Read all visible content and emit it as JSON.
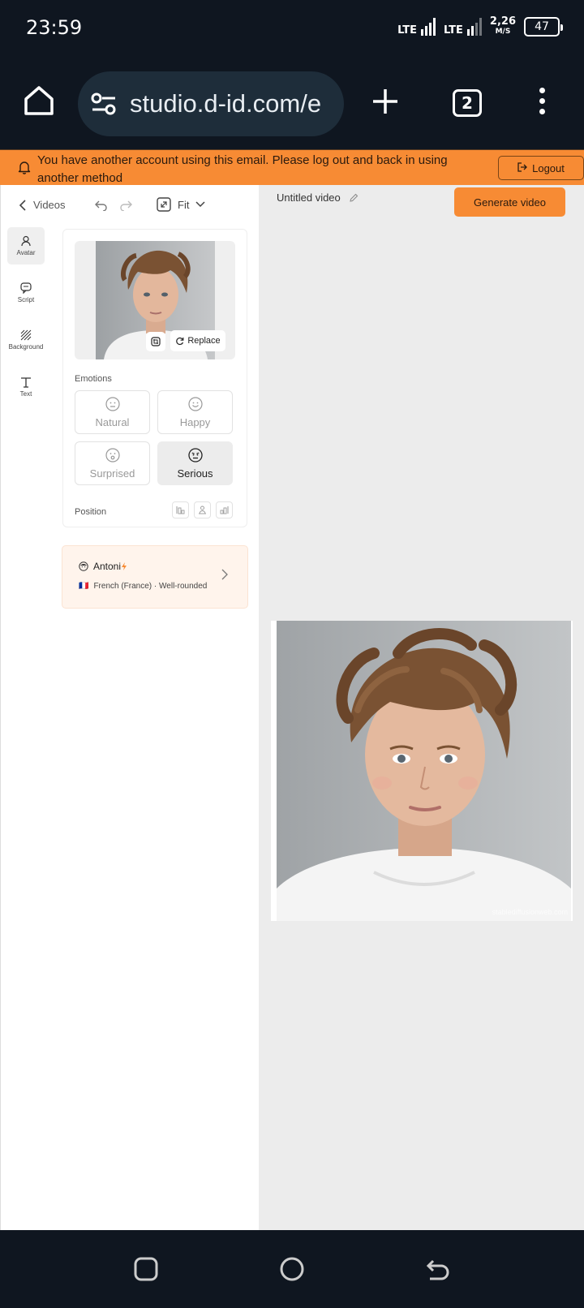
{
  "status": {
    "time": "23:59",
    "network1": "LTE",
    "network2": "LTE",
    "speed_value": "2,26",
    "speed_unit": "M/S",
    "battery": "47"
  },
  "browser": {
    "url": "studio.d-id.com/e",
    "tab_count": "2"
  },
  "banner": {
    "message": "You have another account using this email. Please log out and back in using another method",
    "logout_label": "Logout"
  },
  "editor": {
    "back_label": "Videos",
    "fit_label": "Fit",
    "video_title": "Untitled video",
    "generate_label": "Generate video"
  },
  "rail": {
    "items": [
      {
        "label": "Avatar",
        "icon": "person-icon",
        "active": true
      },
      {
        "label": "Script",
        "icon": "chat-icon",
        "active": false
      },
      {
        "label": "Background",
        "icon": "hatch-icon",
        "active": false
      },
      {
        "label": "Text",
        "icon": "text-icon",
        "active": false
      }
    ]
  },
  "avatar_card": {
    "replace_label": "Replace",
    "emotions_label": "Emotions",
    "emotions": [
      {
        "label": "Natural",
        "selected": false
      },
      {
        "label": "Happy",
        "selected": false
      },
      {
        "label": "Surprised",
        "selected": false
      },
      {
        "label": "Serious",
        "selected": true
      }
    ],
    "position_label": "Position"
  },
  "voice": {
    "name": "Antoni",
    "flag": "🇫🇷",
    "description": "French (France) · Well-rounded"
  },
  "preview": {
    "watermark": "stablediffusionweb.com"
  },
  "colors": {
    "accent": "#f78b34",
    "dark": "#0f1620",
    "canvas": "#ececec"
  }
}
